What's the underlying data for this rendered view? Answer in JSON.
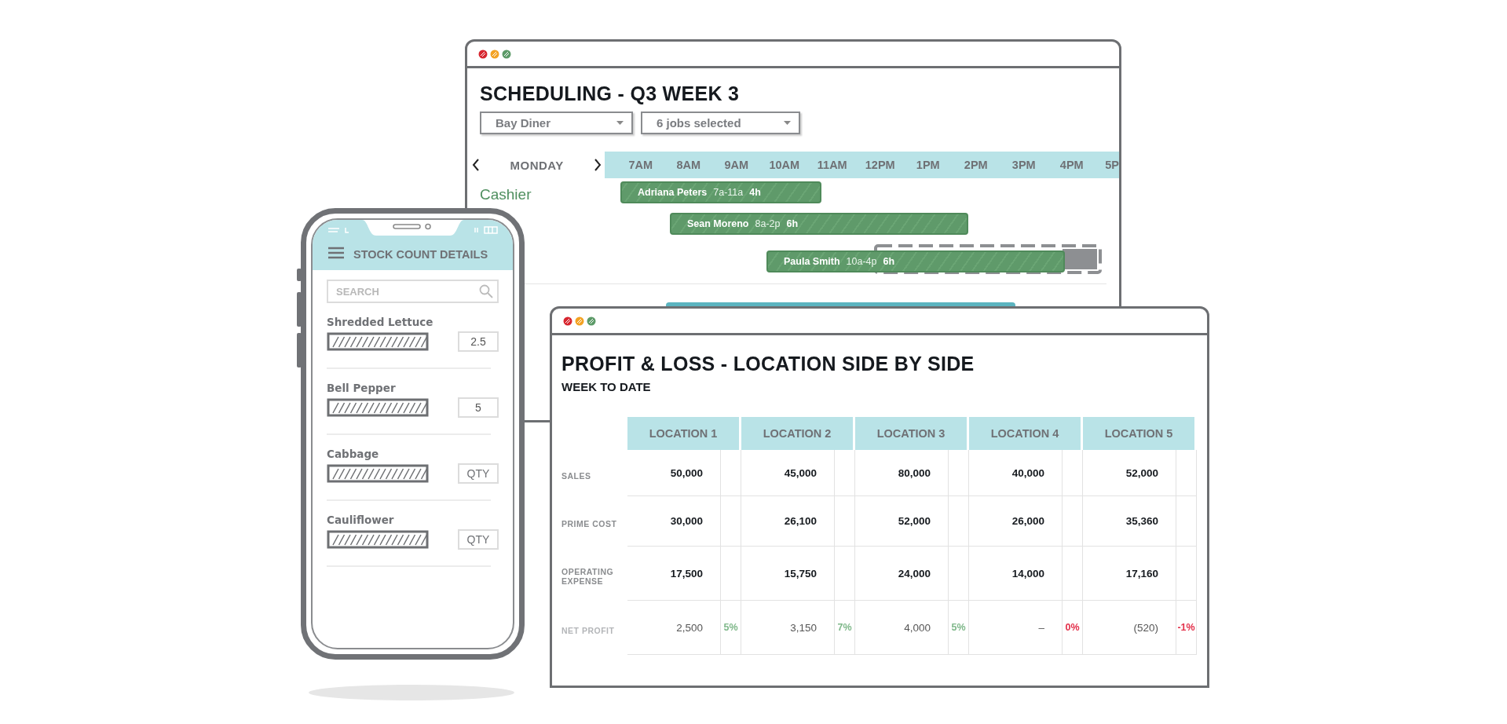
{
  "schedule_window": {
    "title": "SCHEDULING - Q3 WEEK 3",
    "location_select": {
      "value": "Bay Diner"
    },
    "jobs_select": {
      "value": "6 jobs selected"
    },
    "day": "MONDAY",
    "hours": [
      "7AM",
      "8AM",
      "9AM",
      "10AM",
      "11AM",
      "12PM",
      "1PM",
      "2PM",
      "3PM",
      "4PM",
      "5P"
    ],
    "role": "Cashier",
    "shifts": [
      {
        "name": "Adriana Peters",
        "time": "7a-11a",
        "duration": "4h"
      },
      {
        "name": "Sean Moreno",
        "time": "8a-2p",
        "duration": "6h"
      },
      {
        "name": "Paula Smith",
        "time": "10a-4p",
        "duration": "6h"
      }
    ]
  },
  "phone": {
    "title": "STOCK COUNT DETAILS",
    "search": {
      "placeholder": "SEARCH"
    },
    "items": [
      {
        "name": "Shredded Lettuce",
        "value": "2.5"
      },
      {
        "name": "Bell Pepper",
        "value": "5"
      },
      {
        "name": "Cabbage",
        "placeholder": "QTY"
      },
      {
        "name": "Cauliflower",
        "placeholder": "QTY"
      }
    ]
  },
  "pl_window": {
    "title": "PROFIT & LOSS - LOCATION SIDE BY SIDE",
    "subtitle": "WEEK TO DATE",
    "columns": [
      "LOCATION 1",
      "LOCATION 2",
      "LOCATION 3",
      "LOCATION 4",
      "LOCATION 5"
    ],
    "rows": [
      {
        "label": "SALES",
        "bold": true,
        "cells": [
          {
            "value": "50,000"
          },
          {
            "value": "45,000"
          },
          {
            "value": "80,000"
          },
          {
            "value": "40,000"
          },
          {
            "value": "52,000"
          }
        ]
      },
      {
        "label": "PRIME COST",
        "bold": true,
        "cells": [
          {
            "value": "30,000"
          },
          {
            "value": "26,100"
          },
          {
            "value": "52,000"
          },
          {
            "value": "26,000"
          },
          {
            "value": "35,360"
          }
        ]
      },
      {
        "label": "OPERATING EXPENSE",
        "bold": true,
        "cells": [
          {
            "value": "17,500"
          },
          {
            "value": "15,750"
          },
          {
            "value": "24,000"
          },
          {
            "value": "14,000"
          },
          {
            "value": "17,160"
          }
        ]
      },
      {
        "label": "NET PROFIT",
        "bold": false,
        "cells": [
          {
            "value": "2,500",
            "percent": "5%",
            "color": "#7fb88a"
          },
          {
            "value": "3,150",
            "percent": "7%",
            "color": "#7fb88a"
          },
          {
            "value": "4,000",
            "percent": "5%",
            "color": "#7fb88a"
          },
          {
            "value": "–",
            "percent": "0%",
            "color": "#e3304a"
          },
          {
            "value": "(520)",
            "percent": "-1%",
            "color": "#e3304a"
          }
        ]
      }
    ]
  }
}
